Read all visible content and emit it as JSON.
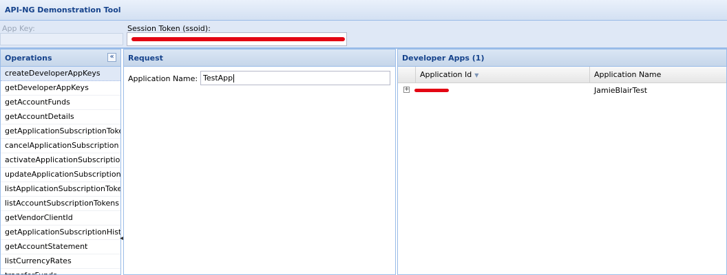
{
  "app": {
    "title": "API-NG Demonstration Tool"
  },
  "credentials": {
    "app_key_label": "App Key:",
    "session_token_label": "Session Token (ssoid):",
    "session_token_redacted": true
  },
  "operations": {
    "title": "Operations",
    "collapse_icon": "double-chevron-left-icon",
    "items": [
      "createDeveloperAppKeys",
      "getDeveloperAppKeys",
      "getAccountFunds",
      "getAccountDetails",
      "getApplicationSubscriptionToken",
      "cancelApplicationSubscription",
      "activateApplicationSubscription",
      "updateApplicationSubscription",
      "listApplicationSubscriptionTokens",
      "listAccountSubscriptionTokens",
      "getVendorClientId",
      "getApplicationSubscriptionHistory",
      "getAccountStatement",
      "listCurrencyRates",
      "transferFunds"
    ],
    "selected_index": 0
  },
  "request": {
    "title": "Request",
    "application_name_label": "Application Name:",
    "application_name_value": "TestApp"
  },
  "developer_apps": {
    "title": "Developer Apps (1)",
    "columns": [
      "Application Id",
      "Application Name"
    ],
    "sort_icon": "sort-desc-icon",
    "rows": [
      {
        "application_id_redacted": true,
        "application_name": "JamieBlairTest"
      }
    ]
  },
  "colors": {
    "header_text": "#15428b",
    "panel_border": "#99bbe8",
    "redaction": "#e30613",
    "selected_row": "#dfe8f6"
  }
}
